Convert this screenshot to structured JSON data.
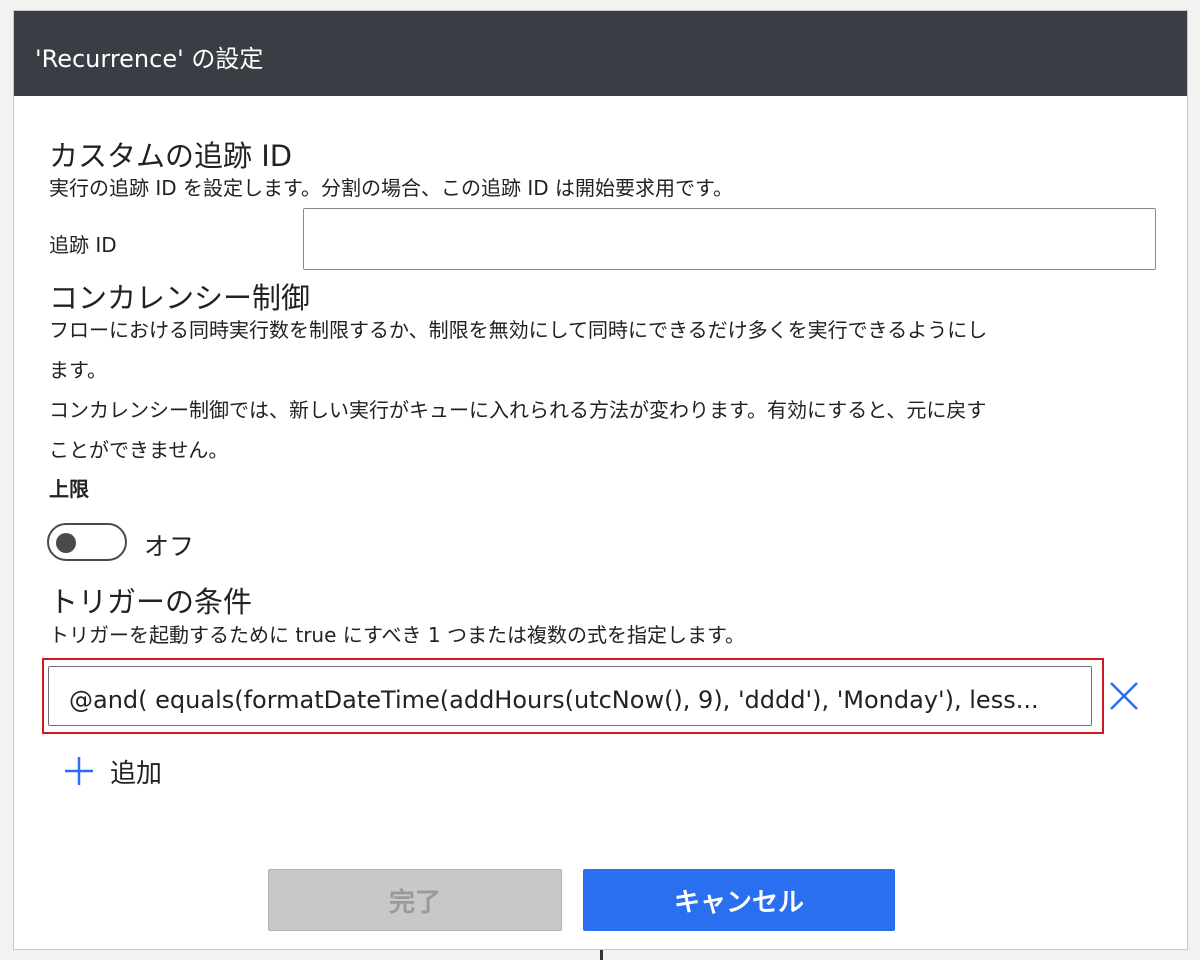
{
  "dialog": {
    "title": "'Recurrence' の設定"
  },
  "tracking": {
    "heading": "カスタムの追跡 ID",
    "description": "実行の追跡 ID を設定します。分割の場合、この追跡 ID は開始要求用です。",
    "field_label": "追跡 ID",
    "field_value": ""
  },
  "concurrency": {
    "heading": "コンカレンシー制御",
    "description_line1": "フローにおける同時実行数を制限するか、制限を無効にして同時にできるだけ多くを実行できるようにし",
    "description_line2": "ます。",
    "description_line3": "コンカレンシー制御では、新しい実行がキューに入れられる方法が変わります。有効にすると、元に戻す",
    "description_line4": "ことができません。",
    "limit_label": "上限",
    "toggle_state": "オフ"
  },
  "trigger_conditions": {
    "heading": "トリガーの条件",
    "description": "トリガーを起動するために true にすべき 1 つまたは複数の式を指定します。",
    "condition_value": "@and(    equals(formatDateTime(addHours(utcNow(), 9), 'dddd'), 'Monday'),    less...",
    "add_label": "追加"
  },
  "footer": {
    "done_label": "完了",
    "cancel_label": "キャンセル"
  },
  "colors": {
    "titlebar": "#3b3d45",
    "accent_blue": "#2a6ff0",
    "highlight_red": "#d0191f",
    "disabled_gray": "#c8c8c8"
  },
  "icons": {
    "remove": "close-icon",
    "add": "plus-icon"
  }
}
